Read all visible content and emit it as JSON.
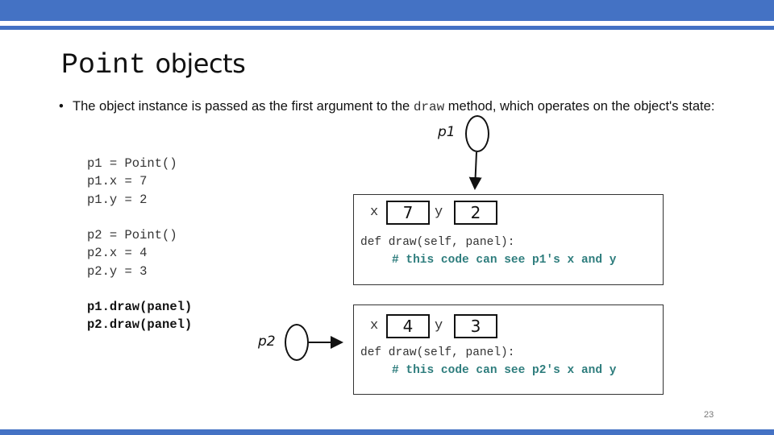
{
  "slide": {
    "title_code": "Point",
    "title_text": "objects",
    "bullet": {
      "text_before": "The object instance is passed as the first argument to the ",
      "code": "draw",
      "text_after": " method, which operates on the object's state:"
    },
    "code_lines": {
      "block1": [
        "p1 = Point()",
        "p1.x = 7",
        "p1.y = 2"
      ],
      "block2": [
        "p2 = Point()",
        "p2.x = 4",
        "p2.y = 3"
      ],
      "block3": [
        "p1.draw(panel)",
        "p2.draw(panel)"
      ]
    },
    "objects": [
      {
        "ref_label": "p1",
        "x_label": "x",
        "x_value": "7",
        "y_label": "y",
        "y_value": "2",
        "method_signature": "def draw(self, panel):",
        "method_comment": "# this code can see p1's x and y"
      },
      {
        "ref_label": "p2",
        "x_label": "x",
        "x_value": "4",
        "y_label": "y",
        "y_value": "3",
        "method_signature": "def draw(self, panel):",
        "method_comment": "# this code can see p2's x and y"
      }
    ],
    "page_number": "23",
    "colors": {
      "accent": "#4472c4",
      "comment": "#2e7d7d"
    }
  }
}
